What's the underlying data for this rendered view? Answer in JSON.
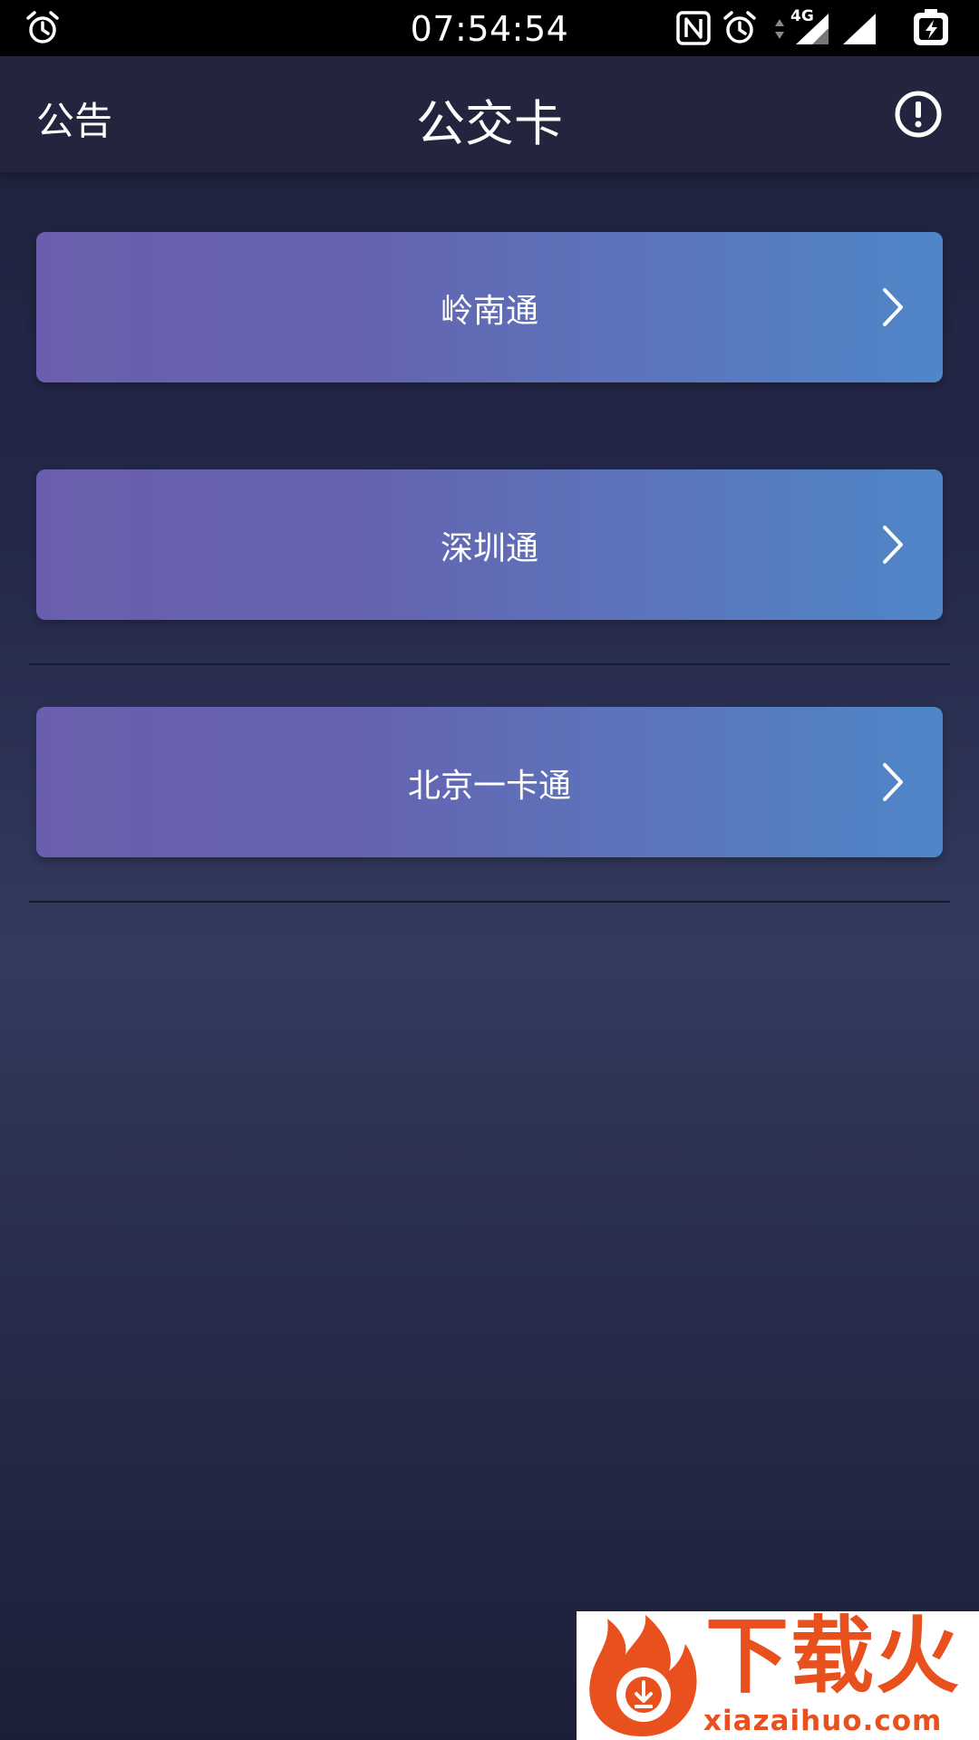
{
  "status_bar": {
    "time": "07:54:54",
    "network": "4G",
    "icons": [
      "alarm-icon",
      "nfc-icon",
      "alarm-icon",
      "data-arrows-icon",
      "signal-icon",
      "signal-icon",
      "battery-charging-icon"
    ]
  },
  "header": {
    "left_label": "公告",
    "title": "公交卡",
    "right_icon": "info-icon"
  },
  "cards": [
    {
      "label": "岭南通",
      "icon": "chevron-right-icon"
    },
    {
      "label": "深圳通",
      "icon": "chevron-right-icon"
    },
    {
      "label": "北京一卡通",
      "icon": "chevron-right-icon"
    }
  ],
  "watermark": {
    "brand": "下载火",
    "url": "xiazaihuo.com"
  },
  "colors": {
    "status_bar": "#000000",
    "header": "#22253d",
    "card_gradient_start": "#6a5fae",
    "card_gradient_end": "#4f86c8",
    "watermark_accent": "#e8501e"
  }
}
